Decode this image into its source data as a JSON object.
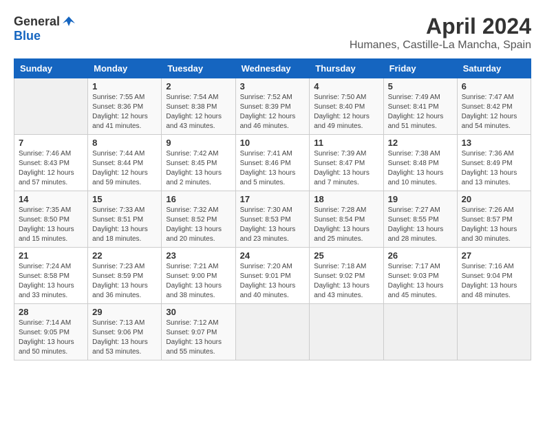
{
  "header": {
    "logo_general": "General",
    "logo_blue": "Blue",
    "month_title": "April 2024",
    "location": "Humanes, Castille-La Mancha, Spain"
  },
  "days_of_week": [
    "Sunday",
    "Monday",
    "Tuesday",
    "Wednesday",
    "Thursday",
    "Friday",
    "Saturday"
  ],
  "weeks": [
    [
      {
        "day": "",
        "info": ""
      },
      {
        "day": "1",
        "info": "Sunrise: 7:55 AM\nSunset: 8:36 PM\nDaylight: 12 hours\nand 41 minutes."
      },
      {
        "day": "2",
        "info": "Sunrise: 7:54 AM\nSunset: 8:38 PM\nDaylight: 12 hours\nand 43 minutes."
      },
      {
        "day": "3",
        "info": "Sunrise: 7:52 AM\nSunset: 8:39 PM\nDaylight: 12 hours\nand 46 minutes."
      },
      {
        "day": "4",
        "info": "Sunrise: 7:50 AM\nSunset: 8:40 PM\nDaylight: 12 hours\nand 49 minutes."
      },
      {
        "day": "5",
        "info": "Sunrise: 7:49 AM\nSunset: 8:41 PM\nDaylight: 12 hours\nand 51 minutes."
      },
      {
        "day": "6",
        "info": "Sunrise: 7:47 AM\nSunset: 8:42 PM\nDaylight: 12 hours\nand 54 minutes."
      }
    ],
    [
      {
        "day": "7",
        "info": "Sunrise: 7:46 AM\nSunset: 8:43 PM\nDaylight: 12 hours\nand 57 minutes."
      },
      {
        "day": "8",
        "info": "Sunrise: 7:44 AM\nSunset: 8:44 PM\nDaylight: 12 hours\nand 59 minutes."
      },
      {
        "day": "9",
        "info": "Sunrise: 7:42 AM\nSunset: 8:45 PM\nDaylight: 13 hours\nand 2 minutes."
      },
      {
        "day": "10",
        "info": "Sunrise: 7:41 AM\nSunset: 8:46 PM\nDaylight: 13 hours\nand 5 minutes."
      },
      {
        "day": "11",
        "info": "Sunrise: 7:39 AM\nSunset: 8:47 PM\nDaylight: 13 hours\nand 7 minutes."
      },
      {
        "day": "12",
        "info": "Sunrise: 7:38 AM\nSunset: 8:48 PM\nDaylight: 13 hours\nand 10 minutes."
      },
      {
        "day": "13",
        "info": "Sunrise: 7:36 AM\nSunset: 8:49 PM\nDaylight: 13 hours\nand 13 minutes."
      }
    ],
    [
      {
        "day": "14",
        "info": "Sunrise: 7:35 AM\nSunset: 8:50 PM\nDaylight: 13 hours\nand 15 minutes."
      },
      {
        "day": "15",
        "info": "Sunrise: 7:33 AM\nSunset: 8:51 PM\nDaylight: 13 hours\nand 18 minutes."
      },
      {
        "day": "16",
        "info": "Sunrise: 7:32 AM\nSunset: 8:52 PM\nDaylight: 13 hours\nand 20 minutes."
      },
      {
        "day": "17",
        "info": "Sunrise: 7:30 AM\nSunset: 8:53 PM\nDaylight: 13 hours\nand 23 minutes."
      },
      {
        "day": "18",
        "info": "Sunrise: 7:28 AM\nSunset: 8:54 PM\nDaylight: 13 hours\nand 25 minutes."
      },
      {
        "day": "19",
        "info": "Sunrise: 7:27 AM\nSunset: 8:55 PM\nDaylight: 13 hours\nand 28 minutes."
      },
      {
        "day": "20",
        "info": "Sunrise: 7:26 AM\nSunset: 8:57 PM\nDaylight: 13 hours\nand 30 minutes."
      }
    ],
    [
      {
        "day": "21",
        "info": "Sunrise: 7:24 AM\nSunset: 8:58 PM\nDaylight: 13 hours\nand 33 minutes."
      },
      {
        "day": "22",
        "info": "Sunrise: 7:23 AM\nSunset: 8:59 PM\nDaylight: 13 hours\nand 36 minutes."
      },
      {
        "day": "23",
        "info": "Sunrise: 7:21 AM\nSunset: 9:00 PM\nDaylight: 13 hours\nand 38 minutes."
      },
      {
        "day": "24",
        "info": "Sunrise: 7:20 AM\nSunset: 9:01 PM\nDaylight: 13 hours\nand 40 minutes."
      },
      {
        "day": "25",
        "info": "Sunrise: 7:18 AM\nSunset: 9:02 PM\nDaylight: 13 hours\nand 43 minutes."
      },
      {
        "day": "26",
        "info": "Sunrise: 7:17 AM\nSunset: 9:03 PM\nDaylight: 13 hours\nand 45 minutes."
      },
      {
        "day": "27",
        "info": "Sunrise: 7:16 AM\nSunset: 9:04 PM\nDaylight: 13 hours\nand 48 minutes."
      }
    ],
    [
      {
        "day": "28",
        "info": "Sunrise: 7:14 AM\nSunset: 9:05 PM\nDaylight: 13 hours\nand 50 minutes."
      },
      {
        "day": "29",
        "info": "Sunrise: 7:13 AM\nSunset: 9:06 PM\nDaylight: 13 hours\nand 53 minutes."
      },
      {
        "day": "30",
        "info": "Sunrise: 7:12 AM\nSunset: 9:07 PM\nDaylight: 13 hours\nand 55 minutes."
      },
      {
        "day": "",
        "info": ""
      },
      {
        "day": "",
        "info": ""
      },
      {
        "day": "",
        "info": ""
      },
      {
        "day": "",
        "info": ""
      }
    ]
  ]
}
